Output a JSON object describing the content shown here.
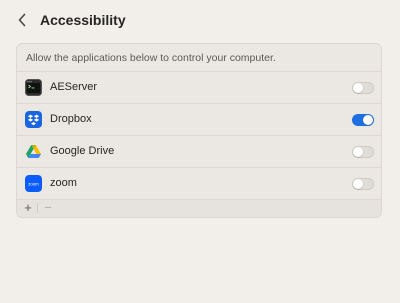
{
  "header": {
    "title": "Accessibility",
    "back_icon": "chevron-left-icon"
  },
  "panel": {
    "description": "Allow the applications below to control your computer.",
    "apps": [
      {
        "name": "AEServer",
        "icon": "aeserver-app-icon",
        "enabled": false
      },
      {
        "name": "Dropbox",
        "icon": "dropbox-app-icon",
        "enabled": true
      },
      {
        "name": "Google Drive",
        "icon": "google-drive-app-icon",
        "enabled": false
      },
      {
        "name": "zoom",
        "icon": "zoom-app-icon",
        "enabled": false,
        "icon_text": "zoom"
      }
    ],
    "footer": {
      "add_label": "+",
      "remove_label": "−"
    }
  },
  "colors": {
    "accent": "#1f6fe0",
    "background": "#f2eee9",
    "panel": "#ebe7e2"
  }
}
